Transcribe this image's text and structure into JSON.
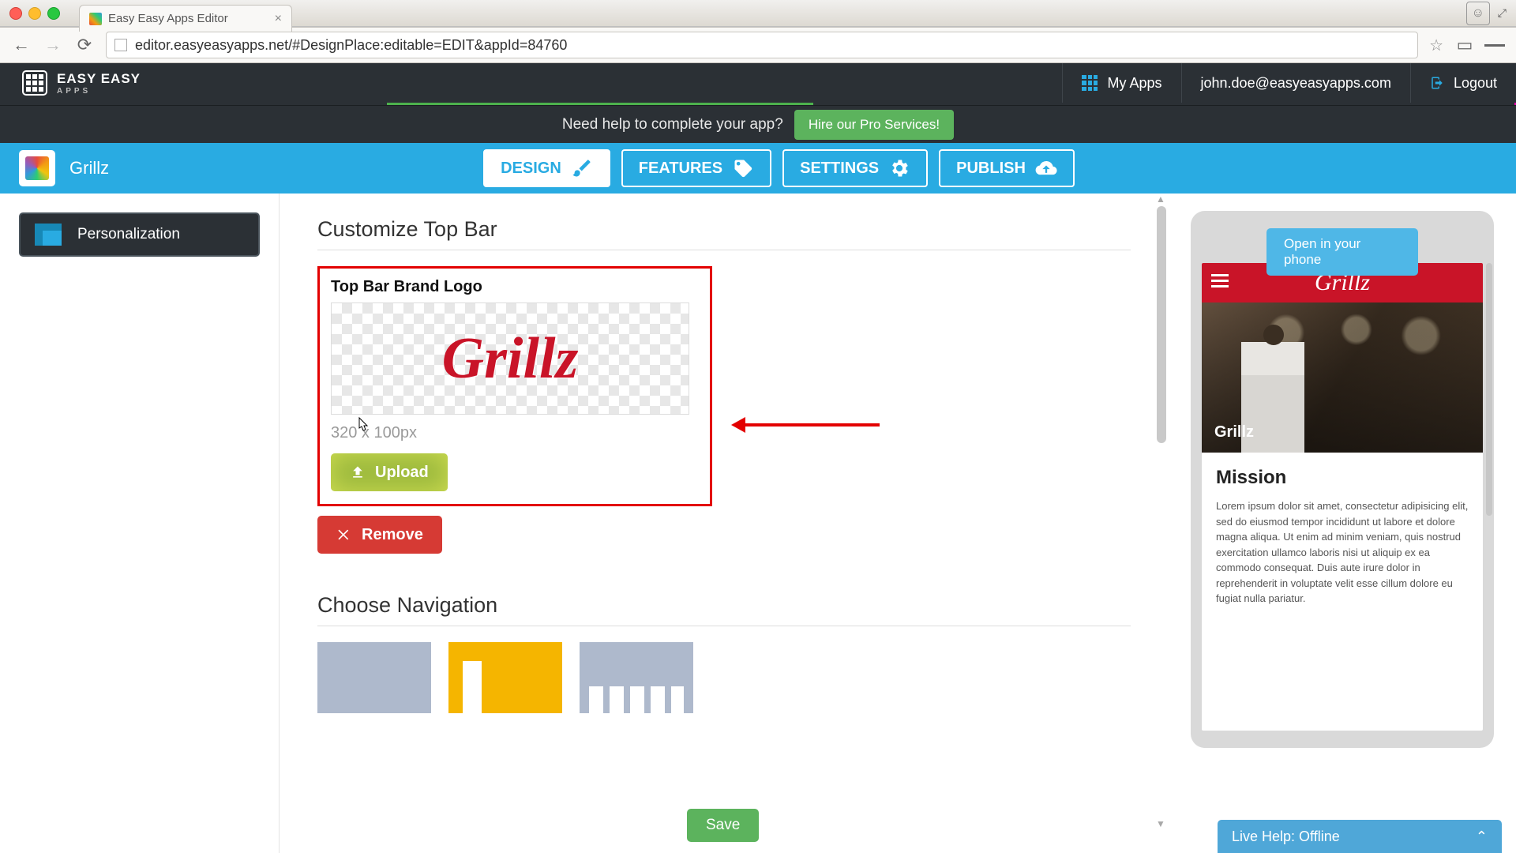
{
  "os": {
    "tab_title": "Easy Easy Apps Editor"
  },
  "browser": {
    "url": "editor.easyeasyapps.net/#DesignPlace:editable=EDIT&appId=84760"
  },
  "header": {
    "brand_line1": "EASY EASY",
    "brand_line2": "APPS",
    "my_apps": "My Apps",
    "user_email": "john.doe@easyeasyapps.com",
    "logout": "Logout"
  },
  "help_bar": {
    "text": "Need help to complete your app?",
    "cta": "Hire our Pro Services!"
  },
  "app": {
    "name": "Grillz"
  },
  "tabs": {
    "design": "DESIGN",
    "features": "FEATURES",
    "settings": "SETTINGS",
    "publish": "PUBLISH"
  },
  "sidebar": {
    "personalization": "Personalization"
  },
  "editor": {
    "section1_title": "Customize Top Bar",
    "logo_label": "Top Bar Brand Logo",
    "logo_text": "Grillz",
    "dimensions": "320 x 100px",
    "upload": "Upload",
    "remove": "Remove",
    "section2_title": "Choose Navigation",
    "save": "Save"
  },
  "preview": {
    "open_btn": "Open in your phone",
    "hero_title": "Grillz",
    "brand": "Grillz",
    "mission_title": "Mission",
    "mission_text": "Lorem ipsum dolor sit amet, consectetur adipisicing elit, sed do eiusmod tempor incididunt ut labore et dolore magna aliqua. Ut enim ad minim veniam, quis nostrud exercitation ullamco laboris nisi ut aliquip ex ea commodo consequat. Duis aute irure dolor in reprehenderit in voluptate velit esse cillum dolore eu fugiat nulla pariatur."
  },
  "live_help": {
    "label": "Live Help: Offline"
  }
}
